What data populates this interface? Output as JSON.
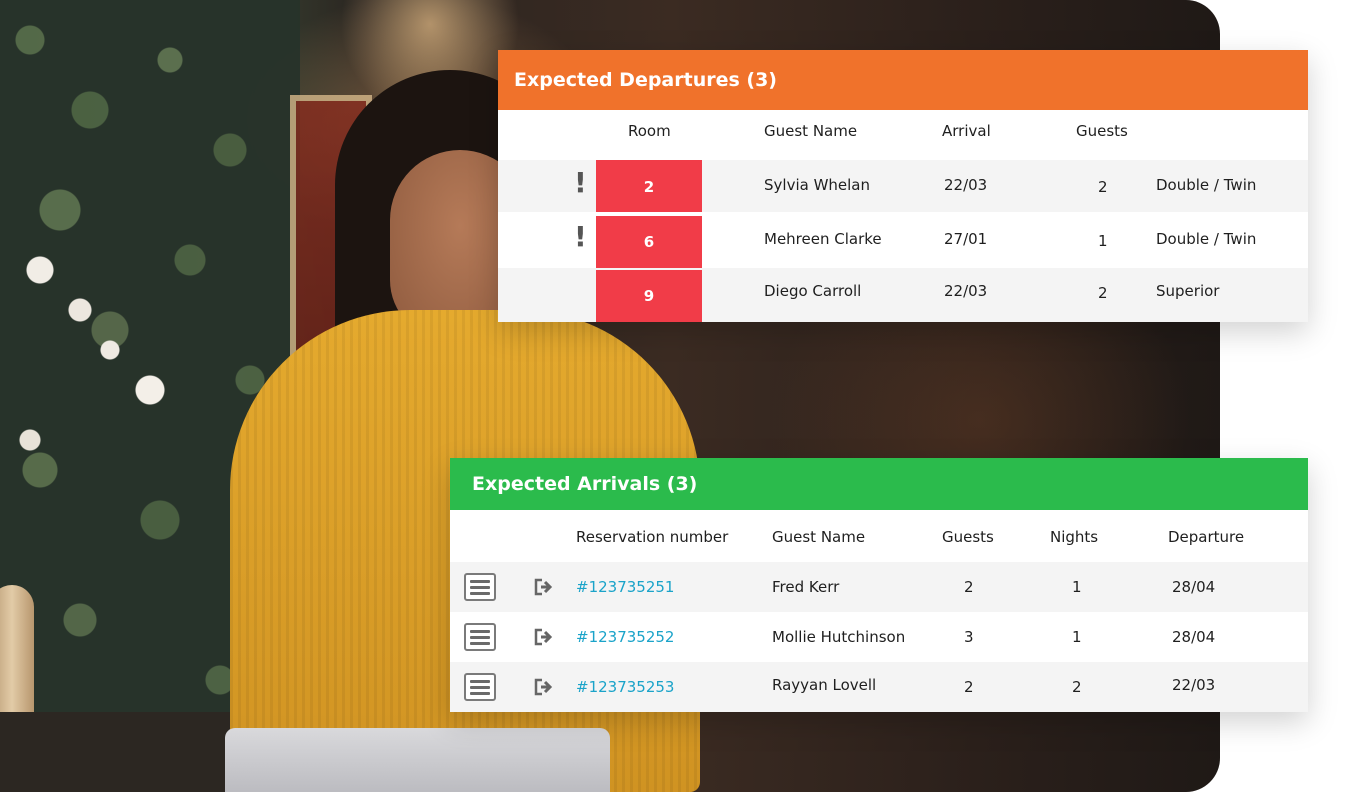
{
  "departures": {
    "title": "Expected Departures (3)",
    "columns": {
      "room": "Room",
      "guest_name": "Guest Name",
      "arrival": "Arrival",
      "guests": "Guests"
    },
    "rows": [
      {
        "alert": "!",
        "room": "2",
        "guest": "Sylvia Whelan",
        "arrival": "22/03",
        "guests": "2",
        "room_type": "Double / Twin"
      },
      {
        "alert": "!",
        "room": "6",
        "guest": "Mehreen Clarke",
        "arrival": "27/01",
        "guests": "1",
        "room_type": "Double / Twin"
      },
      {
        "alert": "",
        "room": "9",
        "guest": "Diego Carroll",
        "arrival": "22/03",
        "guests": "2",
        "room_type": "Superior"
      }
    ],
    "header_color": "#f0722b",
    "room_badge_color": "#f13c48"
  },
  "arrivals": {
    "title": "Expected Arrivals (3)",
    "columns": {
      "reservation": "Reservation number",
      "guest_name": "Guest Name",
      "guests": "Guests",
      "nights": "Nights",
      "departure": "Departure"
    },
    "rows": [
      {
        "reservation": "#123735251",
        "guest": "Fred Kerr",
        "guests": "2",
        "nights": "1",
        "departure": "28/04"
      },
      {
        "reservation": "#123735252",
        "guest": "Mollie Hutchinson",
        "guests": "3",
        "nights": "1",
        "departure": "28/04"
      },
      {
        "reservation": "#123735253",
        "guest": "Rayyan Lovell",
        "guests": "2",
        "nights": "2",
        "departure": "22/03"
      }
    ],
    "row_icons": [
      "menu-icon",
      "check-in-icon"
    ],
    "header_color": "#2bbb4c",
    "link_color": "#1aa3c9"
  }
}
